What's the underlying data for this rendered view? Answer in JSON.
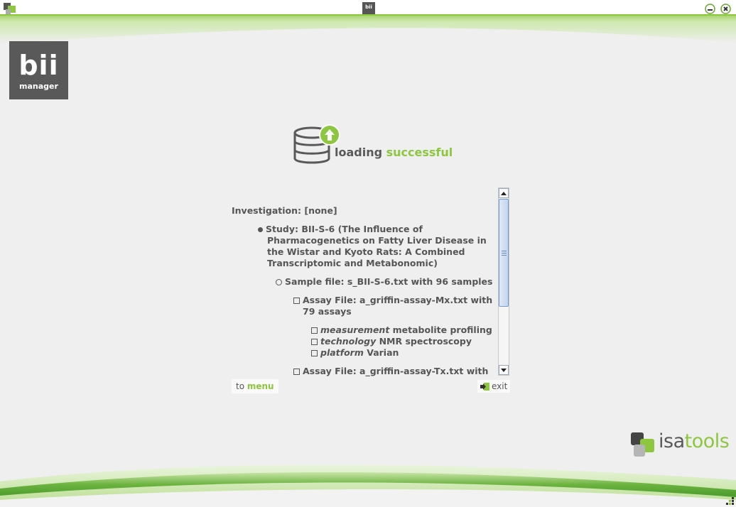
{
  "titlebar": {
    "logo_text": "bii"
  },
  "logo": {
    "big": "bii",
    "small": "manager"
  },
  "status": {
    "prefix": "loading ",
    "highlight": "successful"
  },
  "tree": {
    "investigation": "Investigation: [none]",
    "study_lines": [
      "Study: BII-S-6 (The Influence of",
      "Pharmacogenetics on Fatty Liver Disease in",
      "the Wistar and Kyoto Rats: A Combined",
      "Transcriptomic and Metabonomic)"
    ],
    "sample_file": "Sample file: s_BII-S-6.txt with 96 samples",
    "assay1_lines": [
      "Assay File: a_griffin-assay-Mx.txt with",
      "79 assays"
    ],
    "props": [
      {
        "key": "measurement",
        "value": " metabolite profiling"
      },
      {
        "key": "technology",
        "value": " NMR spectroscopy"
      },
      {
        "key": "platform",
        "value": " Varian"
      }
    ],
    "assay2": "Assay File: a_griffin-assay-Tx.txt with"
  },
  "buttons": {
    "to_prefix": "to ",
    "menu": "menu",
    "exit": "exit"
  },
  "brand": {
    "prefix": "isa",
    "suffix": "tools"
  },
  "colors": {
    "accent_green": "#8dc63f",
    "dark_gray": "#595959",
    "background": "#efefef"
  }
}
